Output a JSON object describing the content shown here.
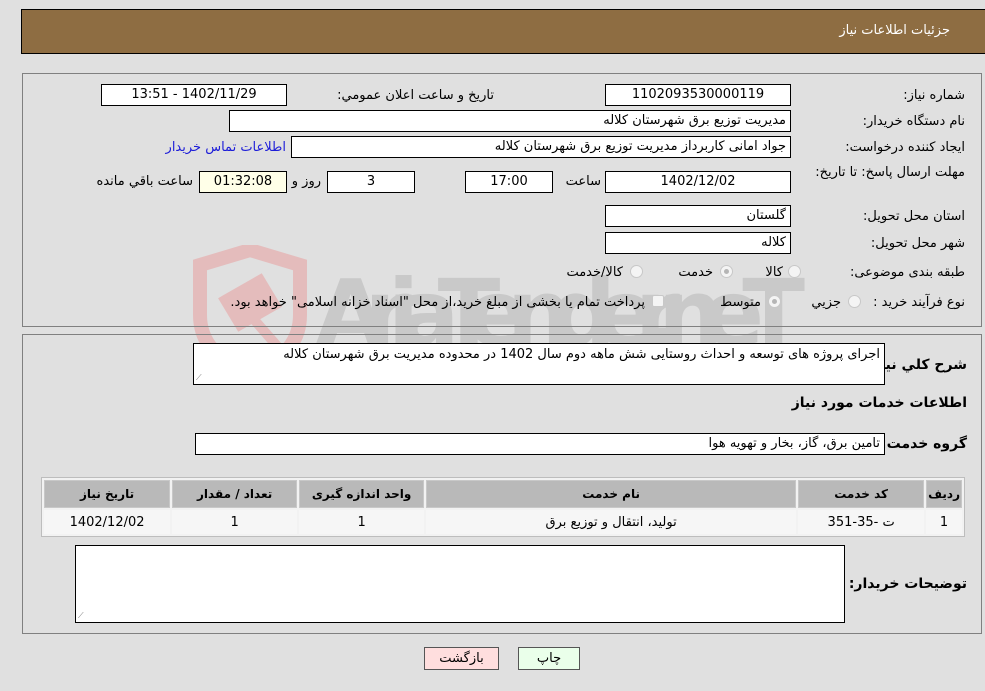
{
  "header": {
    "title": "جزئیات اطلاعات نیاز"
  },
  "details": {
    "need_number_label": "شماره نیاز:",
    "need_number": "1102093530000119",
    "announce_label": "تاریخ و ساعت اعلان عمومي:",
    "announce_value": "1402/11/29 - 13:51",
    "buyer_org_label": "نام دستگاه خریدار:",
    "buyer_org": "مدیریت توزیع برق شهرستان کلاله",
    "creator_label": "ایجاد کننده درخواست:",
    "creator": "جواد امانی کاربرداز مدیریت توزیع برق شهرستان کلاله",
    "contact_link": "اطلاعات تماس خریدار",
    "deadline_label": "مهلت ارسال پاسخ: تا تاریخ:",
    "deadline_date": "1402/12/02",
    "time_label": "ساعت",
    "deadline_time": "17:00",
    "days": "3",
    "days_label": "روز و",
    "remaining": "01:32:08",
    "remaining_label": "ساعت باقي مانده",
    "province_label": "استان محل تحویل:",
    "province": "گلستان",
    "city_label": "شهر محل تحویل:",
    "city": "کلاله",
    "category_label": "طبقه بندی موضوعی:",
    "category_options": [
      "کالا",
      "خدمت",
      "کالا/خدمت"
    ],
    "category_selected": "خدمت",
    "process_label": "نوع فرآیند خرید :",
    "process_options": [
      "جزیي",
      "متوسط"
    ],
    "process_selected": "متوسط",
    "treasury_note": "پرداخت تمام یا بخشی از مبلغ خرید،از محل \"اسناد خزانه اسلامی\" خواهد بود."
  },
  "need": {
    "summary_label": "شرح كلي نياز:",
    "summary": "اجرای پروژه های توسعه و احداث روستایی شش ماهه دوم سال 1402 در محدوده مدیریت برق شهرستان کلاله",
    "services_title": "اطلاعات خدمات مورد نياز",
    "service_group_label": "گروه خدمت:",
    "service_group": "تامین برق، گاز، بخار و تهویه هوا",
    "table": {
      "headers": [
        "ردیف",
        "کد خدمت",
        "نام خدمت",
        "واحد اندازه گیری",
        "تعداد / مقدار",
        "تاریخ نیاز"
      ],
      "rows": [
        [
          "1",
          "ت -35-351",
          "تولید، انتقال و توزیع برق",
          "1",
          "1",
          "1402/12/02"
        ]
      ]
    },
    "buyer_notes_label": "توضیحات خریدار:",
    "buyer_notes": ""
  },
  "buttons": {
    "print": "چاپ",
    "back": "بازگشت"
  },
  "watermark": "AriaTender.neT"
}
